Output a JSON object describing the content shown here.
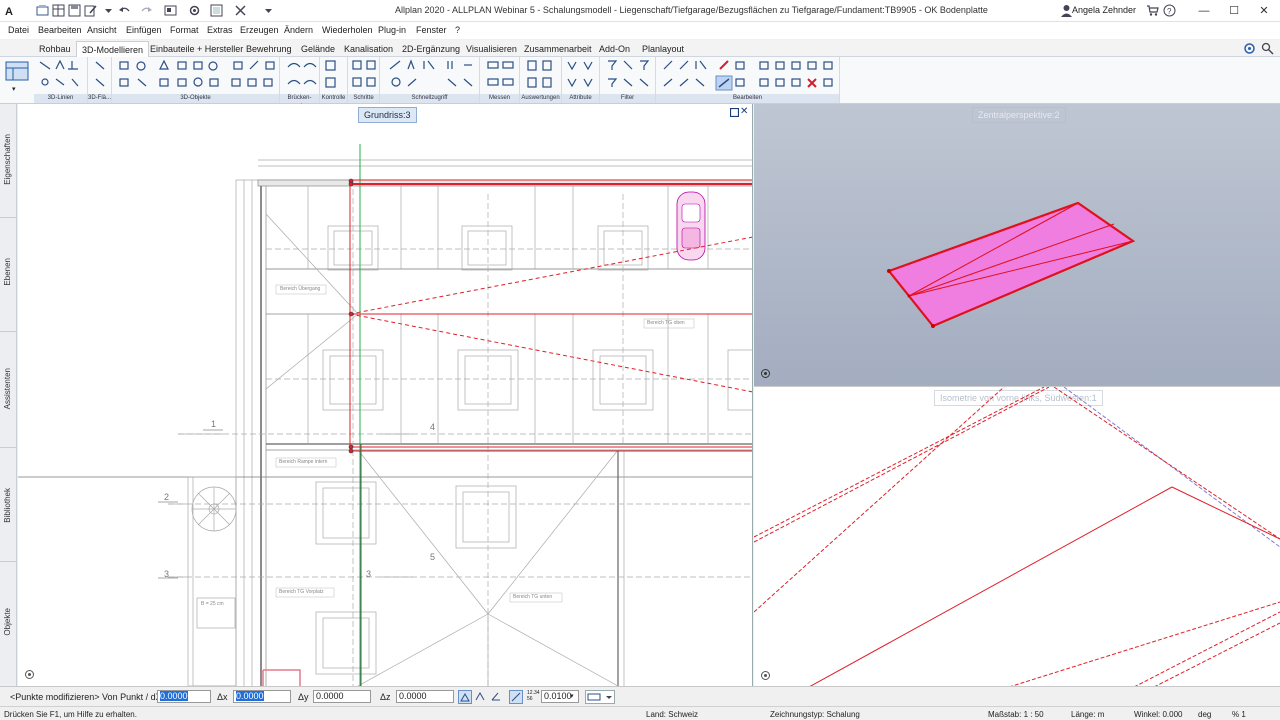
{
  "window": {
    "title": "Allplan 2020 - ALLPLAN Webinar 5 - Schalungsmodell - Liegenschaft/Tiefgarage/Bezugsflächen zu Tiefgarage/Fundament:TB9905 - OK Bodenplatte",
    "user": "Angela Zehnder",
    "help_icon": "?"
  },
  "menu": [
    "Datei",
    "Bearbeiten",
    "Ansicht",
    "Einfügen",
    "Format",
    "Extras",
    "Erzeugen",
    "Ändern",
    "Wiederholen",
    "Plug-in",
    "Fenster",
    "?"
  ],
  "ribbon_tabs": [
    "Rohbau",
    "3D-Modellieren",
    "Einbauteile + Hersteller",
    "Bewehrung",
    "Gelände",
    "Kanalisation",
    "2D-Ergänzung",
    "Visualisieren",
    "Zusammenarbeit",
    "Add-On",
    "Planlayout"
  ],
  "active_tab": "3D-Modellieren",
  "ribbon_groups": [
    "3D-Linien",
    "3D-Flä...",
    "3D-Objekte",
    "Brücken- und...",
    "Kontrolle",
    "Schritte",
    "Schnellzugriff",
    "Messen",
    "Auswertungen",
    "Attribute",
    "Filter",
    "Bearbeiten"
  ],
  "side_tabs": [
    "Eigenschaften",
    "Ebenen",
    "Assistenten",
    "Bibliothek",
    "Objekte"
  ],
  "viewports": {
    "grundriss": {
      "title": "Grundriss:3",
      "labels": [
        "Bereich Übergang",
        "Bereich TG oben",
        "Bereich Rampe intern",
        "Bereich TG Vorplatz",
        "Bereich TG unten"
      ],
      "axis_numbers": [
        "1",
        "2",
        "3",
        "4",
        "3",
        "5"
      ],
      "note": "B = 25 cm"
    },
    "zentral": {
      "title": "Zentralperspektive:2"
    },
    "iso": {
      "title": "Isometrie von vorne links, Südwesten:1"
    }
  },
  "input_line": {
    "prompt": "<Punkte modifizieren> Von Punkt / dX",
    "dx_value": "0.0000",
    "dx_label": "Δx",
    "dx2_value": "0.0000",
    "dy_label": "Δy",
    "dy_value": "0.0000",
    "dz_label": "Δz",
    "dz_value": "0.0000",
    "zoom_value": "0.0100",
    "coord_label": "12.34\n56"
  },
  "status": {
    "help": "Drücken Sie F1, um Hilfe zu erhalten.",
    "land": "Land:   Schweiz",
    "zeichnungstyp": "Zeichnungstyp:   Schalung",
    "massstab": "Maßstab:  1 : 50",
    "laenge": "Länge:   m",
    "winkel": "Winkel:   0.000",
    "deg": "deg",
    "percent": "%   1"
  },
  "colors": {
    "accent": "#1e6fd9",
    "slab_fill": "#f07ee0",
    "slab_edge": "#e0101c",
    "red_line": "#e0202a"
  }
}
